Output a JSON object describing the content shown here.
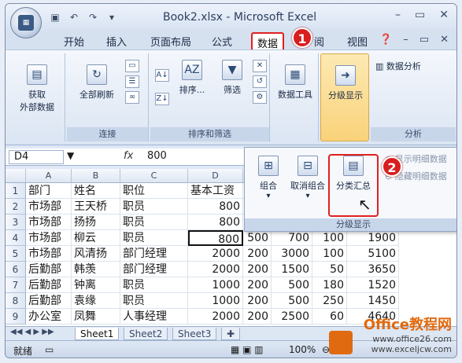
{
  "window": {
    "title": "Book2.xlsx - Microsoft Excel"
  },
  "qat": {
    "icons": [
      "save-icon",
      "undo-icon",
      "redo-icon"
    ]
  },
  "tabs": [
    {
      "label": "开始"
    },
    {
      "label": "插入"
    },
    {
      "label": "页面布局"
    },
    {
      "label": "公式"
    },
    {
      "label": "数据",
      "active": true
    },
    {
      "label": "阅"
    },
    {
      "label": "视图"
    }
  ],
  "badges": {
    "one": "1",
    "two": "2"
  },
  "ribbon": {
    "get_external": {
      "label": "获取\n外部数据"
    },
    "refresh_all": {
      "label": "全部刷新"
    },
    "connections_group": "连接",
    "sort": {
      "label": "排序..."
    },
    "filter": {
      "label": "筛选"
    },
    "sort_filter_group": "排序和筛选",
    "data_tools": {
      "label": "数据工具"
    },
    "outline": {
      "label": "分级显示"
    },
    "data_analysis": {
      "label": "数据分析"
    },
    "analysis_group": "分析"
  },
  "formula_bar": {
    "name_box": "D4",
    "fx": "fx",
    "value": "800"
  },
  "panel": {
    "group_btn": "组合",
    "ungroup_btn": "取消组合",
    "subtotal_btn": "分类汇总",
    "show_detail": "显示明细数据",
    "hide_detail": "隐藏明细数据",
    "label": "分级显示"
  },
  "columns": [
    "A",
    "B",
    "C",
    "D"
  ],
  "rows": [
    {
      "n": "1",
      "a": "部门",
      "b": "姓名",
      "c": "职位",
      "d": "基本工资",
      "e": "",
      "f": "",
      "g": "",
      "h": ""
    },
    {
      "n": "2",
      "a": "市场部",
      "b": "王天桥",
      "c": "职员",
      "d": "800",
      "e": "",
      "f": "",
      "g": "",
      "h": ""
    },
    {
      "n": "3",
      "a": "市场部",
      "b": "扬扬",
      "c": "职员",
      "d": "800",
      "e": "",
      "f": "",
      "g": "",
      "h": ""
    },
    {
      "n": "4",
      "a": "市场部",
      "b": "柳云",
      "c": "职员",
      "d": "800",
      "e": "500",
      "f": "700",
      "g": "100",
      "h": "1900"
    },
    {
      "n": "5",
      "a": "市场部",
      "b": "风清扬",
      "c": "部门经理",
      "d": "2000",
      "e": "200",
      "f": "3000",
      "g": "100",
      "h": "5100"
    },
    {
      "n": "6",
      "a": "后勤部",
      "b": "韩羡",
      "c": "部门经理",
      "d": "2000",
      "e": "200",
      "f": "1500",
      "g": "50",
      "h": "3650"
    },
    {
      "n": "7",
      "a": "后勤部",
      "b": "钟离",
      "c": "职员",
      "d": "1000",
      "e": "200",
      "f": "500",
      "g": "180",
      "h": "1520"
    },
    {
      "n": "8",
      "a": "后勤部",
      "b": "袁缘",
      "c": "职员",
      "d": "1000",
      "e": "200",
      "f": "500",
      "g": "250",
      "h": "1450"
    },
    {
      "n": "9",
      "a": "办公室",
      "b": "凤舞",
      "c": "人事经理",
      "d": "2000",
      "e": "200",
      "f": "2500",
      "g": "60",
      "h": "4640"
    }
  ],
  "sheets": [
    "Sheet1",
    "Sheet2",
    "Sheet3"
  ],
  "status": {
    "ready": "就绪",
    "zoom": "100%"
  },
  "watermark": {
    "title": "Office教程网",
    "url": "www.office26.com",
    "url2": "www.exceljcw.com"
  }
}
